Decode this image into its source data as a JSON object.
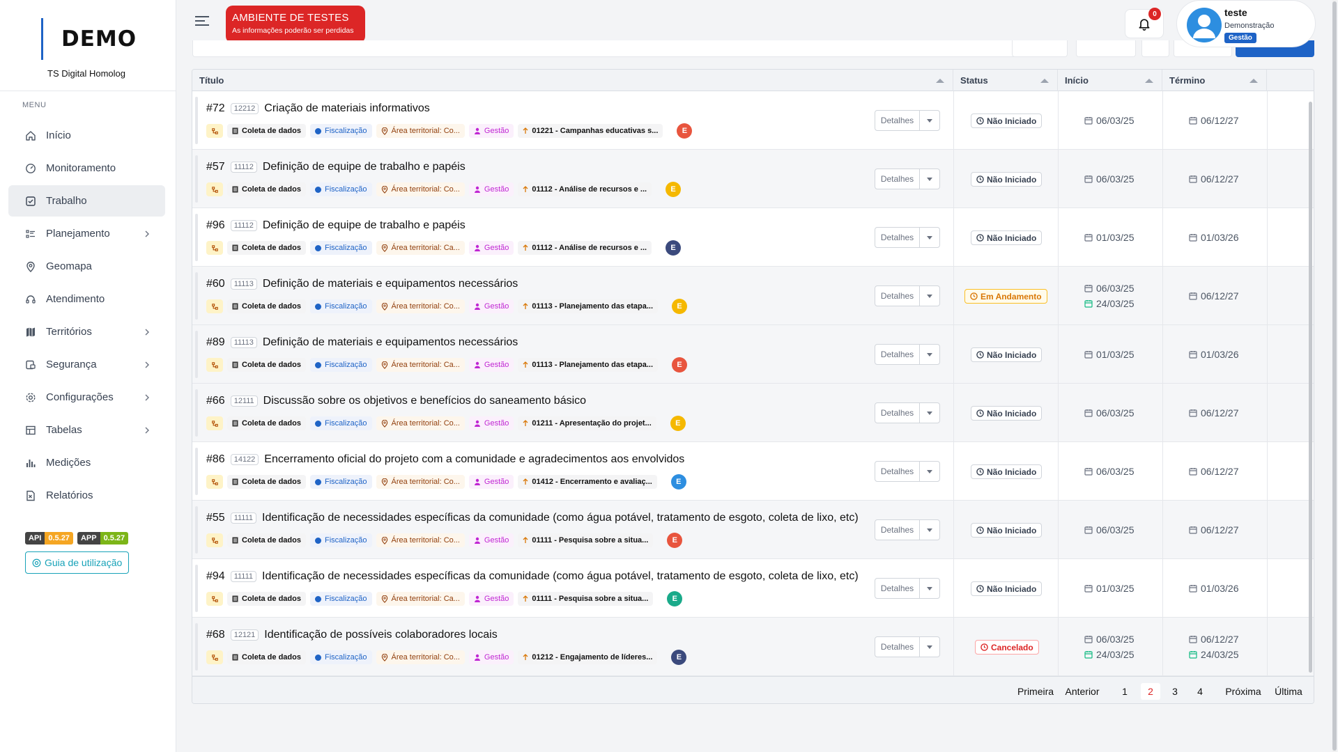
{
  "brand": {
    "logo": "DEMO",
    "subtitle": "TS Digital Homolog"
  },
  "menu_label": "MENU",
  "nav": [
    {
      "label": "Início",
      "icon": "home-icon",
      "chevron": false,
      "active": false
    },
    {
      "label": "Monitoramento",
      "icon": "gauge-icon",
      "chevron": false,
      "active": false
    },
    {
      "label": "Trabalho",
      "icon": "checkbox-icon",
      "chevron": false,
      "active": true
    },
    {
      "label": "Planejamento",
      "icon": "list-icon",
      "chevron": true,
      "active": false
    },
    {
      "label": "Geomapa",
      "icon": "map-pin-icon",
      "chevron": false,
      "active": false
    },
    {
      "label": "Atendimento",
      "icon": "headset-icon",
      "chevron": false,
      "active": false
    },
    {
      "label": "Territórios",
      "icon": "map-icon",
      "chevron": true,
      "active": false
    },
    {
      "label": "Segurança",
      "icon": "shield-icon",
      "chevron": true,
      "active": false
    },
    {
      "label": "Configurações",
      "icon": "gear-icon",
      "chevron": true,
      "active": false
    },
    {
      "label": "Tabelas",
      "icon": "table-icon",
      "chevron": true,
      "active": false
    },
    {
      "label": "Medições",
      "icon": "bar-chart-icon",
      "chevron": false,
      "active": false
    },
    {
      "label": "Relatórios",
      "icon": "report-icon",
      "chevron": false,
      "active": false
    }
  ],
  "versions": {
    "api_key": "API",
    "api_value": "0.5.27",
    "app_key": "APP",
    "app_value": "0.5.27"
  },
  "guide_button": "Guia de utilização",
  "banner": {
    "title": "AMBIENTE DE TESTES",
    "subtitle": "As informações poderão ser perdidas"
  },
  "notifications": {
    "count": "0"
  },
  "user": {
    "name": "teste",
    "role": "Demonstração",
    "badge": "Gestão"
  },
  "table": {
    "headers": {
      "title": "Título",
      "status": "Status",
      "start": "Início",
      "end": "Término"
    },
    "details_label": "Detalhes",
    "rows": [
      {
        "num": "#72",
        "code": "12212",
        "title": "Criação de materiais informativos",
        "tag_coleta": "Coleta de dados",
        "tag_fisc": "Fiscalização",
        "tag_area": "Área territorial: Co...",
        "tag_gestao": "Gestão",
        "tag_plan": "01221 - Campanhas educativas s...",
        "avatar": "E",
        "avatar_color": "#e8553e",
        "status": "Não Iniciado",
        "status_kind": "ni",
        "start": "06/03/25",
        "start2": "",
        "end": "06/12/27",
        "end2": ""
      },
      {
        "num": "#57",
        "code": "11112",
        "title": "Definição de equipe de trabalho e papéis",
        "tag_coleta": "Coleta de dados",
        "tag_fisc": "Fiscalização",
        "tag_area": "Área territorial: Co...",
        "tag_gestao": "Gestão",
        "tag_plan": "01112 - Análise de recursos e ...",
        "avatar": "E",
        "avatar_color": "#f5b800",
        "status": "Não Iniciado",
        "status_kind": "ni",
        "start": "06/03/25",
        "start2": "",
        "end": "06/12/27",
        "end2": ""
      },
      {
        "num": "#96",
        "code": "11112",
        "title": "Definição de equipe de trabalho e papéis",
        "tag_coleta": "Coleta de dados",
        "tag_fisc": "Fiscalização",
        "tag_area": "Área territorial: Ca...",
        "tag_gestao": "Gestão",
        "tag_plan": "01112 - Análise de recursos e ...",
        "avatar": "E",
        "avatar_color": "#3b4a7d",
        "status": "Não Iniciado",
        "status_kind": "ni",
        "start": "01/03/25",
        "start2": "",
        "end": "01/03/26",
        "end2": ""
      },
      {
        "num": "#60",
        "code": "11113",
        "title": "Definição de materiais e equipamentos necessários",
        "tag_coleta": "Coleta de dados",
        "tag_fisc": "Fiscalização",
        "tag_area": "Área territorial: Co...",
        "tag_gestao": "Gestão",
        "tag_plan": "01113 - Planejamento das etapa...",
        "avatar": "E",
        "avatar_color": "#f5b800",
        "status": "Em Andamento",
        "status_kind": "ea",
        "start": "06/03/25",
        "start2": "24/03/25",
        "end": "06/12/27",
        "end2": ""
      },
      {
        "num": "#89",
        "code": "11113",
        "title": "Definição de materiais e equipamentos necessários",
        "tag_coleta": "Coleta de dados",
        "tag_fisc": "Fiscalização",
        "tag_area": "Área territorial: Ca...",
        "tag_gestao": "Gestão",
        "tag_plan": "01113 - Planejamento das etapa...",
        "avatar": "E",
        "avatar_color": "#e8553e",
        "status": "Não Iniciado",
        "status_kind": "ni",
        "start": "01/03/25",
        "start2": "",
        "end": "01/03/26",
        "end2": ""
      },
      {
        "num": "#66",
        "code": "12111",
        "title": "Discussão sobre os objetivos e benefícios do saneamento básico",
        "tag_coleta": "Coleta de dados",
        "tag_fisc": "Fiscalização",
        "tag_area": "Área territorial: Co...",
        "tag_gestao": "Gestão",
        "tag_plan": "01211 - Apresentação do projet...",
        "avatar": "E",
        "avatar_color": "#f5b800",
        "status": "Não Iniciado",
        "status_kind": "ni",
        "start": "06/03/25",
        "start2": "",
        "end": "06/12/27",
        "end2": ""
      },
      {
        "num": "#86",
        "code": "14122",
        "title": "Encerramento oficial do projeto com a comunidade e agradecimentos aos envolvidos",
        "tag_coleta": "Coleta de dados",
        "tag_fisc": "Fiscalização",
        "tag_area": "Área territorial: Co...",
        "tag_gestao": "Gestão",
        "tag_plan": "01412 - Encerramento e avaliaç...",
        "avatar": "E",
        "avatar_color": "#2d8ee0",
        "status": "Não Iniciado",
        "status_kind": "ni",
        "start": "06/03/25",
        "start2": "",
        "end": "06/12/27",
        "end2": ""
      },
      {
        "num": "#55",
        "code": "11111",
        "title": "Identificação de necessidades específicas da comunidade (como água potável, tratamento de esgoto, coleta de lixo, etc)",
        "tag_coleta": "Coleta de dados",
        "tag_fisc": "Fiscalização",
        "tag_area": "Área territorial: Co...",
        "tag_gestao": "Gestão",
        "tag_plan": "01111 - Pesquisa sobre a situa...",
        "avatar": "E",
        "avatar_color": "#e8553e",
        "status": "Não Iniciado",
        "status_kind": "ni",
        "start": "06/03/25",
        "start2": "",
        "end": "06/12/27",
        "end2": ""
      },
      {
        "num": "#94",
        "code": "11111",
        "title": "Identificação de necessidades específicas da comunidade (como água potável, tratamento de esgoto, coleta de lixo, etc)",
        "tag_coleta": "Coleta de dados",
        "tag_fisc": "Fiscalização",
        "tag_area": "Área territorial: Ca...",
        "tag_gestao": "Gestão",
        "tag_plan": "01111 - Pesquisa sobre a situa...",
        "avatar": "E",
        "avatar_color": "#1aaa8a",
        "status": "Não Iniciado",
        "status_kind": "ni",
        "start": "01/03/25",
        "start2": "",
        "end": "01/03/26",
        "end2": ""
      },
      {
        "num": "#68",
        "code": "12121",
        "title": "Identificação de possíveis colaboradores locais",
        "tag_coleta": "Coleta de dados",
        "tag_fisc": "Fiscalização",
        "tag_area": "Área territorial: Co...",
        "tag_gestao": "Gestão",
        "tag_plan": "01212 - Engajamento de líderes...",
        "avatar": "E",
        "avatar_color": "#3b4a7d",
        "status": "Cancelado",
        "status_kind": "ca",
        "start": "06/03/25",
        "start2": "24/03/25",
        "end": "06/12/27",
        "end2": "24/03/25"
      }
    ]
  },
  "pagination": {
    "first": "Primeira",
    "prev": "Anterior",
    "pages": [
      "1",
      "2",
      "3",
      "4"
    ],
    "current": "2",
    "next": "Próxima",
    "last": "Última"
  },
  "colors": {
    "accent": "#1e63c6",
    "danger": "#dc2626",
    "warning": "#d97706",
    "teal": "#17a2b8"
  }
}
